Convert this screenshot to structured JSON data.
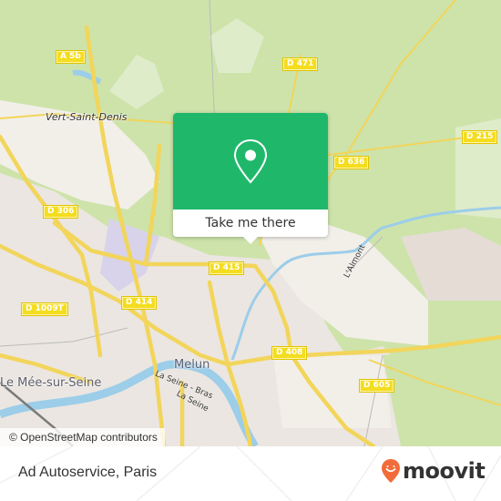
{
  "map": {
    "popup": {
      "button_label": "Take me there",
      "icon": "map-pin-icon",
      "color": "#1fb86b"
    },
    "road_labels": [
      "A 5b",
      "D 471",
      "D 215",
      "D 636",
      "D 306",
      "D 415",
      "D 414",
      "D 1009T",
      "D 408",
      "D 605"
    ],
    "places": {
      "vert_saint_denis": "Vert-Saint-Denis",
      "melun": "Melun",
      "le_mee": "Le Mée-sur-Seine"
    },
    "water_labels": {
      "almont": "L'Almont",
      "seine_bras": "La Seine - Bras",
      "seine": "La Seine"
    },
    "attribution": "© OpenStreetMap contributors"
  },
  "footer": {
    "place_title": "Ad Autoservice, Paris",
    "brand": "moovit",
    "brand_color": "#f26b3a"
  }
}
